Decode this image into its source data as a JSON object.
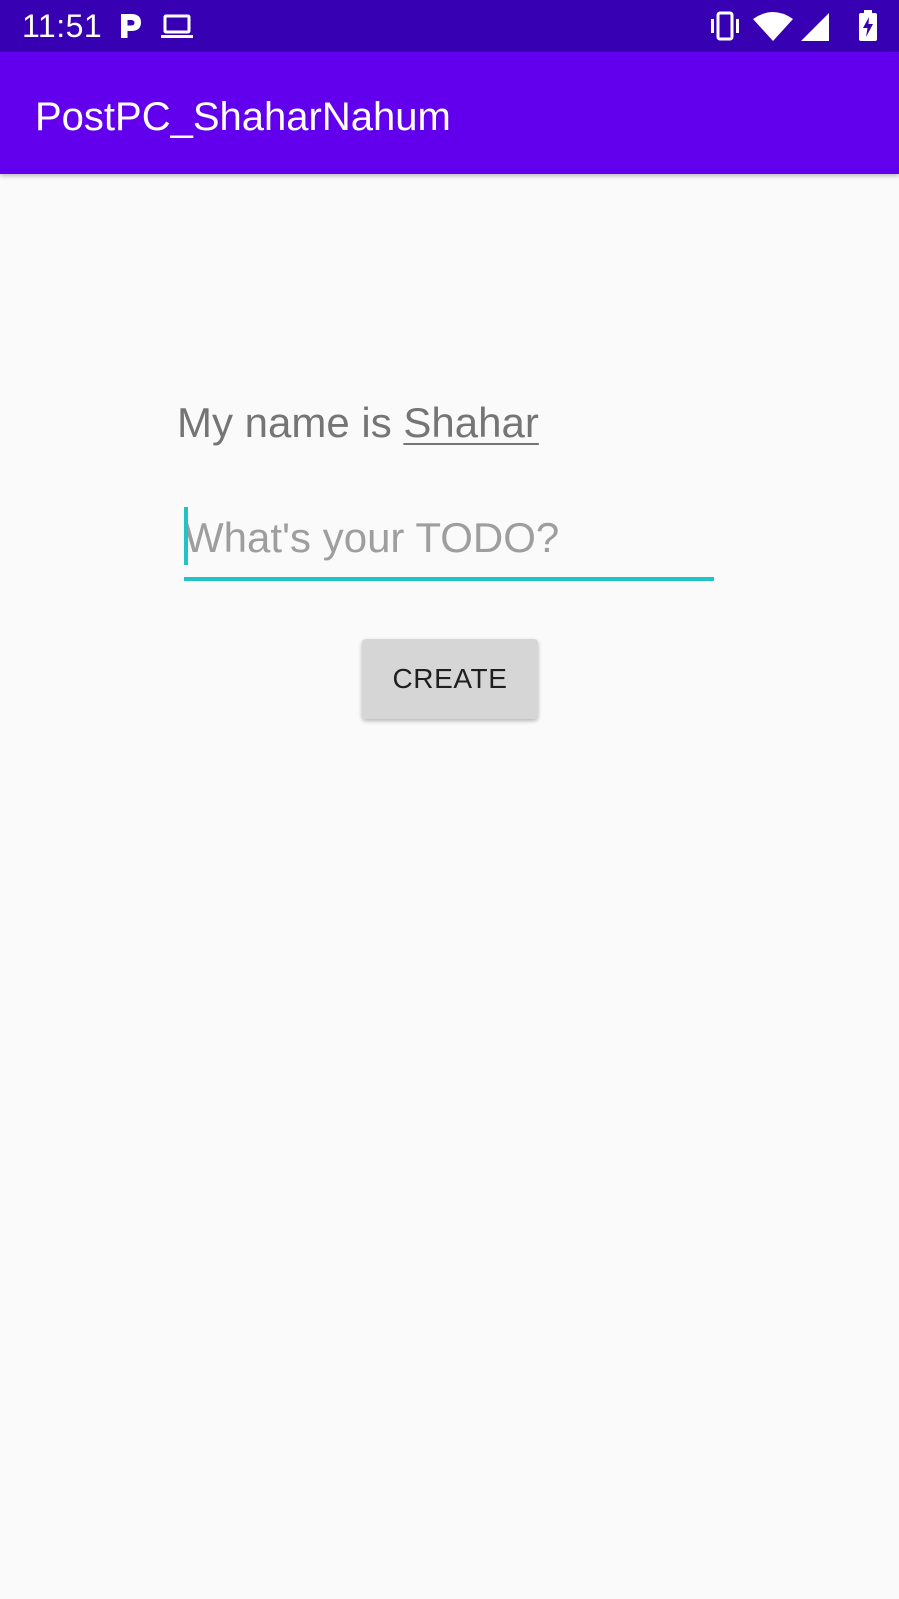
{
  "status_bar": {
    "time": "11:51",
    "left_icons": [
      "parking-p-icon",
      "laptop-icon"
    ],
    "right_icons": [
      "vibrate-icon",
      "wifi-icon",
      "cell-signal-icon",
      "battery-charging-icon"
    ],
    "background": "#3700b3"
  },
  "app_bar": {
    "title": "PostPC_ShaharNahum",
    "background": "#6200ee"
  },
  "main": {
    "name_prefix": "My name is ",
    "name_value": "Shahar",
    "todo_input": {
      "value": "",
      "placeholder": "What's your TODO?"
    },
    "create_label": "CREATE",
    "accent": "#20c4c4"
  }
}
